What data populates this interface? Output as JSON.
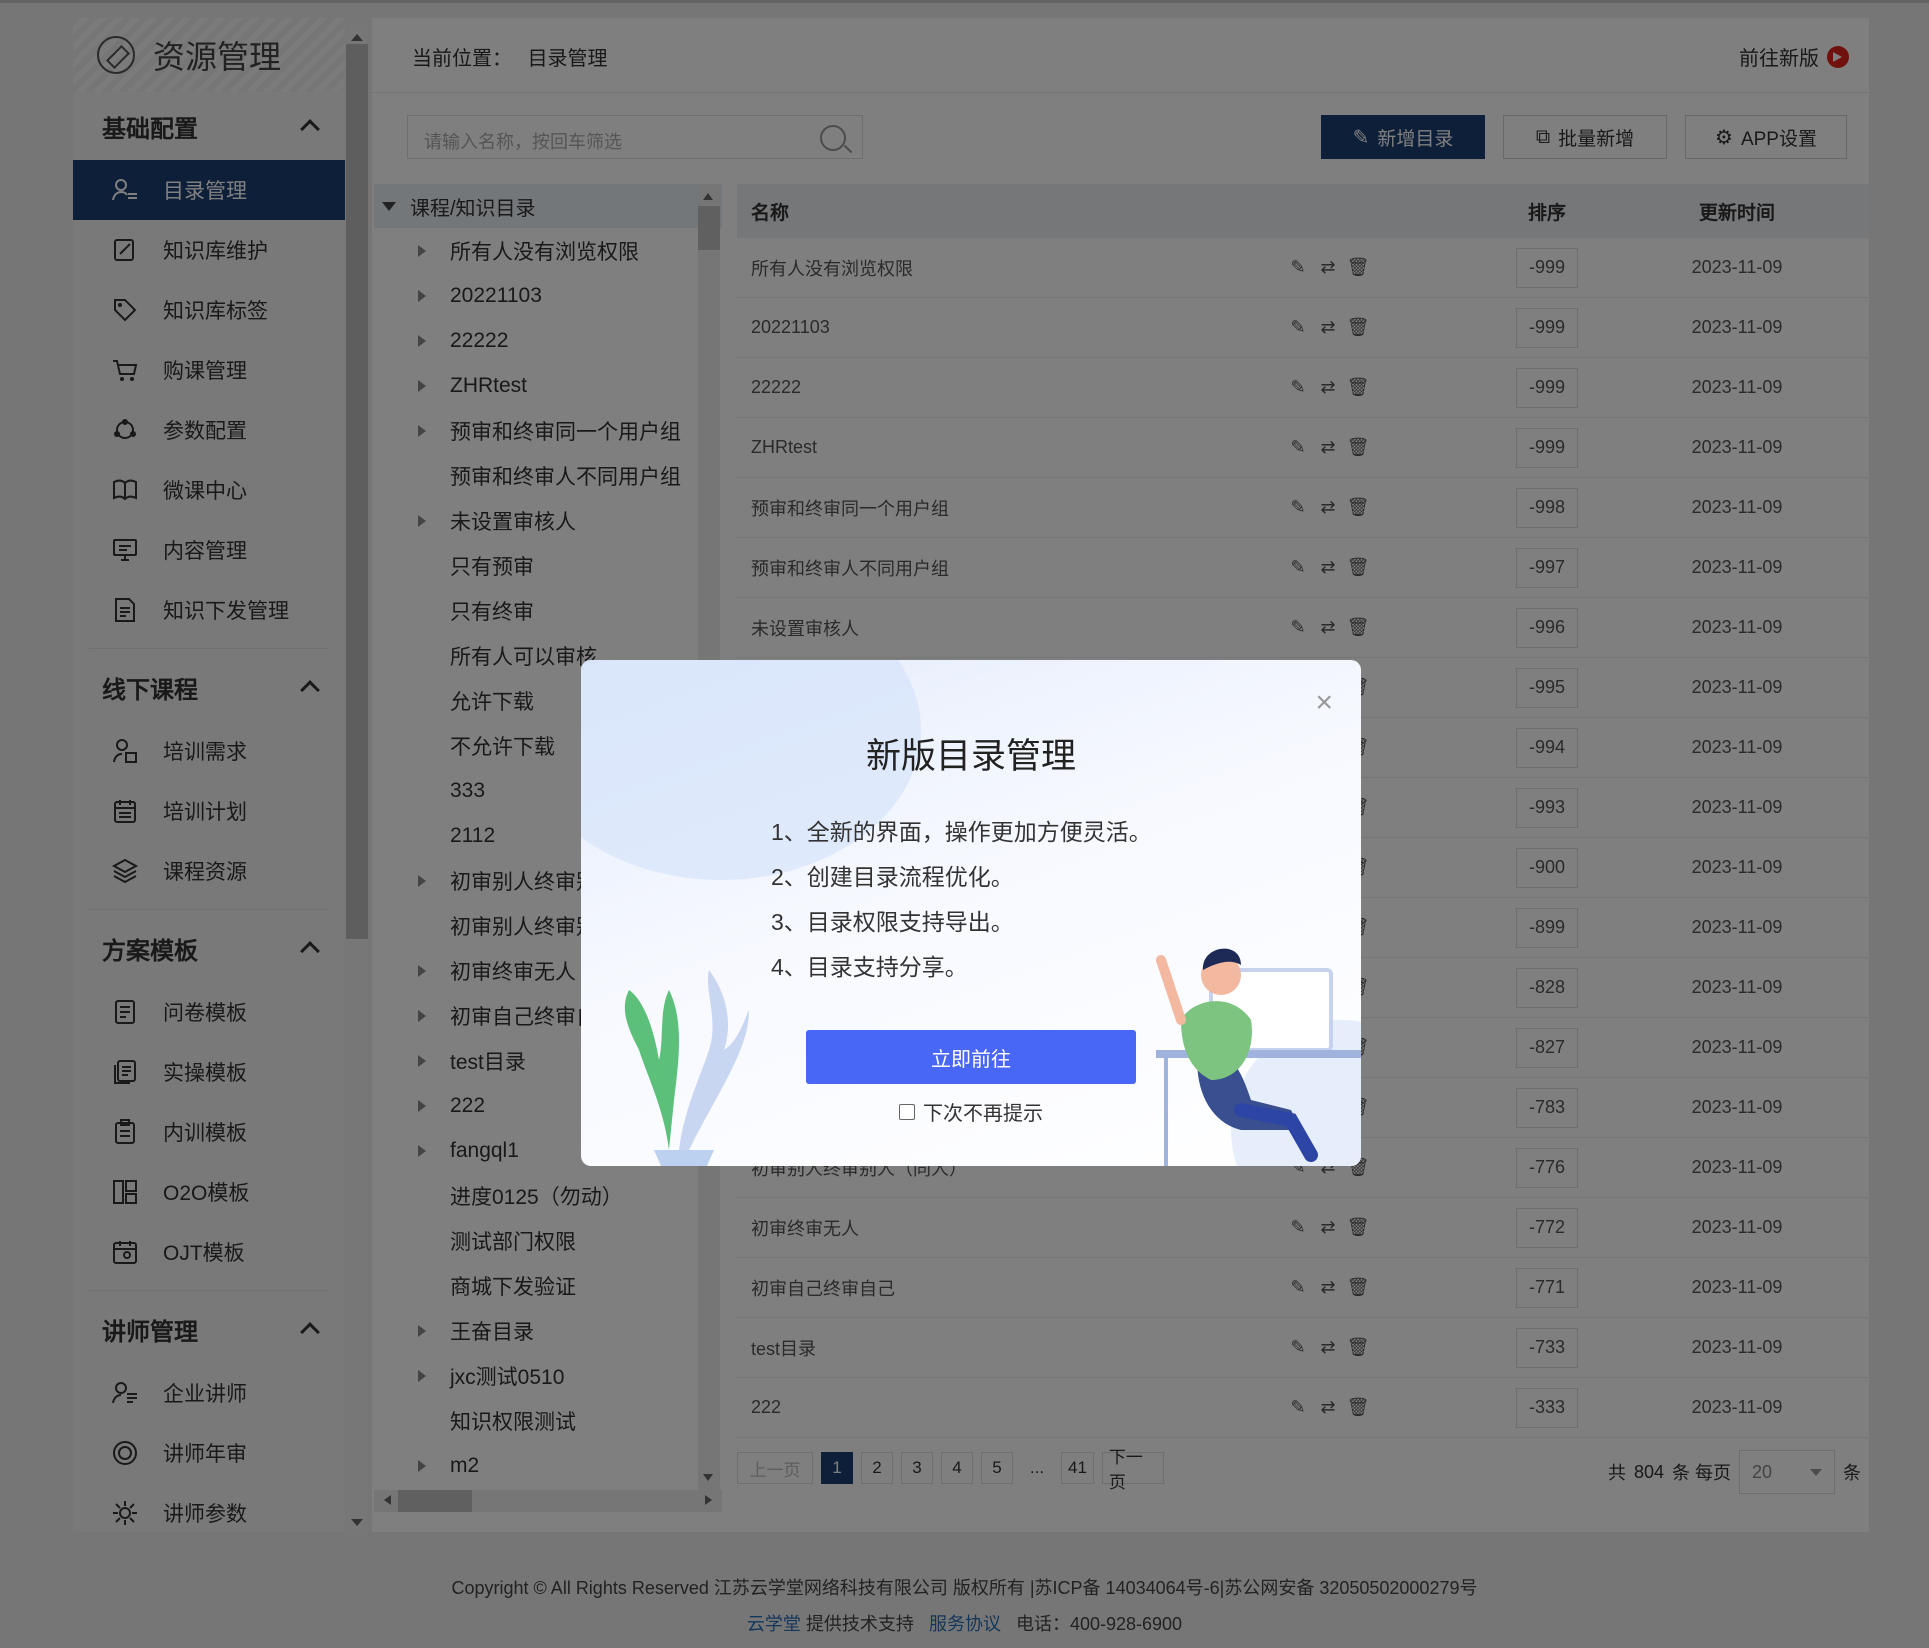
{
  "sidebar": {
    "title": "资源管理",
    "groups": [
      {
        "label": "基础配置",
        "items": [
          {
            "label": "目录管理",
            "icon": "user-list-icon",
            "active": true
          },
          {
            "label": "知识库维护",
            "icon": "edit-book-icon"
          },
          {
            "label": "知识库标签",
            "icon": "tag-icon"
          },
          {
            "label": "购课管理",
            "icon": "cart-icon"
          },
          {
            "label": "参数配置",
            "icon": "nodes-icon"
          },
          {
            "label": "微课中心",
            "icon": "open-book-icon"
          },
          {
            "label": "内容管理",
            "icon": "monitor-icon"
          },
          {
            "label": "知识下发管理",
            "icon": "document-icon"
          }
        ]
      },
      {
        "label": "线下课程",
        "items": [
          {
            "label": "培训需求",
            "icon": "user-doc-icon"
          },
          {
            "label": "培训计划",
            "icon": "calendar-icon"
          },
          {
            "label": "课程资源",
            "icon": "layers-icon"
          }
        ]
      },
      {
        "label": "方案模板",
        "items": [
          {
            "label": "问卷模板",
            "icon": "form-icon"
          },
          {
            "label": "实操模板",
            "icon": "copy-icon"
          },
          {
            "label": "内训模板",
            "icon": "clipboard-icon"
          },
          {
            "label": "O2O模板",
            "icon": "layout-icon"
          },
          {
            "label": "OJT模板",
            "icon": "calendar-user-icon"
          }
        ]
      },
      {
        "label": "讲师管理",
        "items": [
          {
            "label": "企业讲师",
            "icon": "teacher-icon"
          },
          {
            "label": "讲师年审",
            "icon": "audit-icon"
          },
          {
            "label": "讲师参数",
            "icon": "gear-icon"
          }
        ]
      }
    ]
  },
  "header": {
    "crumb_label": "当前位置：",
    "crumb_current": "目录管理",
    "go_new": "前往新版"
  },
  "toolbar": {
    "search_placeholder": "请输入名称，按回车筛选",
    "add_dir": "新增目录",
    "batch_add": "批量新增",
    "app_settings": "APP设置"
  },
  "tree": {
    "root": "课程/知识目录",
    "nodes": [
      {
        "label": "所有人没有浏览权限",
        "expandable": true
      },
      {
        "label": "20221103",
        "expandable": true
      },
      {
        "label": "22222",
        "expandable": true
      },
      {
        "label": "ZHRtest",
        "expandable": true
      },
      {
        "label": "预审和终审同一个用户组",
        "expandable": true
      },
      {
        "label": "预审和终审人不同用户组",
        "expandable": false
      },
      {
        "label": "未设置审核人",
        "expandable": true
      },
      {
        "label": "只有预审",
        "expandable": false
      },
      {
        "label": "只有终审",
        "expandable": false
      },
      {
        "label": "所有人可以审核",
        "expandable": false
      },
      {
        "label": "允许下载",
        "expandable": false
      },
      {
        "label": "不允许下载",
        "expandable": false
      },
      {
        "label": "333",
        "expandable": false
      },
      {
        "label": "2112",
        "expandable": false
      },
      {
        "label": "初审别人终审别",
        "expandable": true
      },
      {
        "label": "初审别人终审别",
        "expandable": false
      },
      {
        "label": "初审终审无人",
        "expandable": true
      },
      {
        "label": "初审自己终审自",
        "expandable": true
      },
      {
        "label": "test目录",
        "expandable": true
      },
      {
        "label": "222",
        "expandable": true
      },
      {
        "label": "fangql1",
        "expandable": true
      },
      {
        "label": "进度0125（勿动）",
        "expandable": false
      },
      {
        "label": "测试部门权限",
        "expandable": false
      },
      {
        "label": "商城下发验证",
        "expandable": false
      },
      {
        "label": "王奋目录",
        "expandable": true
      },
      {
        "label": "jxc测试0510",
        "expandable": true
      },
      {
        "label": "知识权限测试",
        "expandable": false
      },
      {
        "label": "m2",
        "expandable": true
      }
    ]
  },
  "table": {
    "headers": {
      "name": "名称",
      "sort": "排序",
      "time": "更新时间"
    },
    "rows": [
      {
        "name": "所有人没有浏览权限",
        "sort": "-999",
        "time": "2023-11-09"
      },
      {
        "name": "20221103",
        "sort": "-999",
        "time": "2023-11-09"
      },
      {
        "name": "22222",
        "sort": "-999",
        "time": "2023-11-09"
      },
      {
        "name": "ZHRtest",
        "sort": "-999",
        "time": "2023-11-09"
      },
      {
        "name": "预审和终审同一个用户组",
        "sort": "-998",
        "time": "2023-11-09"
      },
      {
        "name": "预审和终审人不同用户组",
        "sort": "-997",
        "time": "2023-11-09"
      },
      {
        "name": "未设置审核人",
        "sort": "-996",
        "time": "2023-11-09"
      },
      {
        "name": "",
        "sort": "-995",
        "time": "2023-11-09"
      },
      {
        "name": "",
        "sort": "-994",
        "time": "2023-11-09"
      },
      {
        "name": "",
        "sort": "-993",
        "time": "2023-11-09"
      },
      {
        "name": "",
        "sort": "-900",
        "time": "2023-11-09"
      },
      {
        "name": "",
        "sort": "-899",
        "time": "2023-11-09"
      },
      {
        "name": "",
        "sort": "-828",
        "time": "2023-11-09"
      },
      {
        "name": "",
        "sort": "-827",
        "time": "2023-11-09"
      },
      {
        "name": "",
        "sort": "-783",
        "time": "2023-11-09"
      },
      {
        "name": "初审别人终审别人（同人）",
        "sort": "-776",
        "time": "2023-11-09"
      },
      {
        "name": "初审终审无人",
        "sort": "-772",
        "time": "2023-11-09"
      },
      {
        "name": "初审自己终审自己",
        "sort": "-771",
        "time": "2023-11-09"
      },
      {
        "name": "test目录",
        "sort": "-733",
        "time": "2023-11-09"
      },
      {
        "name": "222",
        "sort": "-333",
        "time": "2023-11-09"
      }
    ]
  },
  "pager": {
    "prev": "上一页",
    "next": "下一页",
    "pages": [
      "1",
      "2",
      "3",
      "4",
      "5",
      "...",
      "41"
    ],
    "current": "1",
    "total_prefix": "共",
    "total": "804",
    "total_suffix": "条 每页",
    "page_size": "20",
    "unit": "条"
  },
  "footer": {
    "line1": "Copyright © All Rights Reserved 江苏云学堂网络科技有限公司  版权所有 |苏ICP备 14034064号-6|苏公网安备 32050502000279号",
    "brand": "云学堂",
    "support": "提供技术支持",
    "agreement": "服务协议",
    "phone": "电话：400-928-6900"
  },
  "modal": {
    "title": "新版目录管理",
    "items": [
      "1、全新的界面，操作更加方便灵活。",
      "2、创建目录流程优化。",
      "3、目录权限支持导出。",
      "4、目录支持分享。"
    ],
    "go_button": "立即前往",
    "dont_show": "下次不再提示",
    "close": "×"
  },
  "colors": {
    "nav_active": "#1d3f72",
    "primary_button": "#1d3f72",
    "modal_button": "#4867f6",
    "go_new_icon": "#e2231a",
    "footer_link": "#2a6db6"
  }
}
